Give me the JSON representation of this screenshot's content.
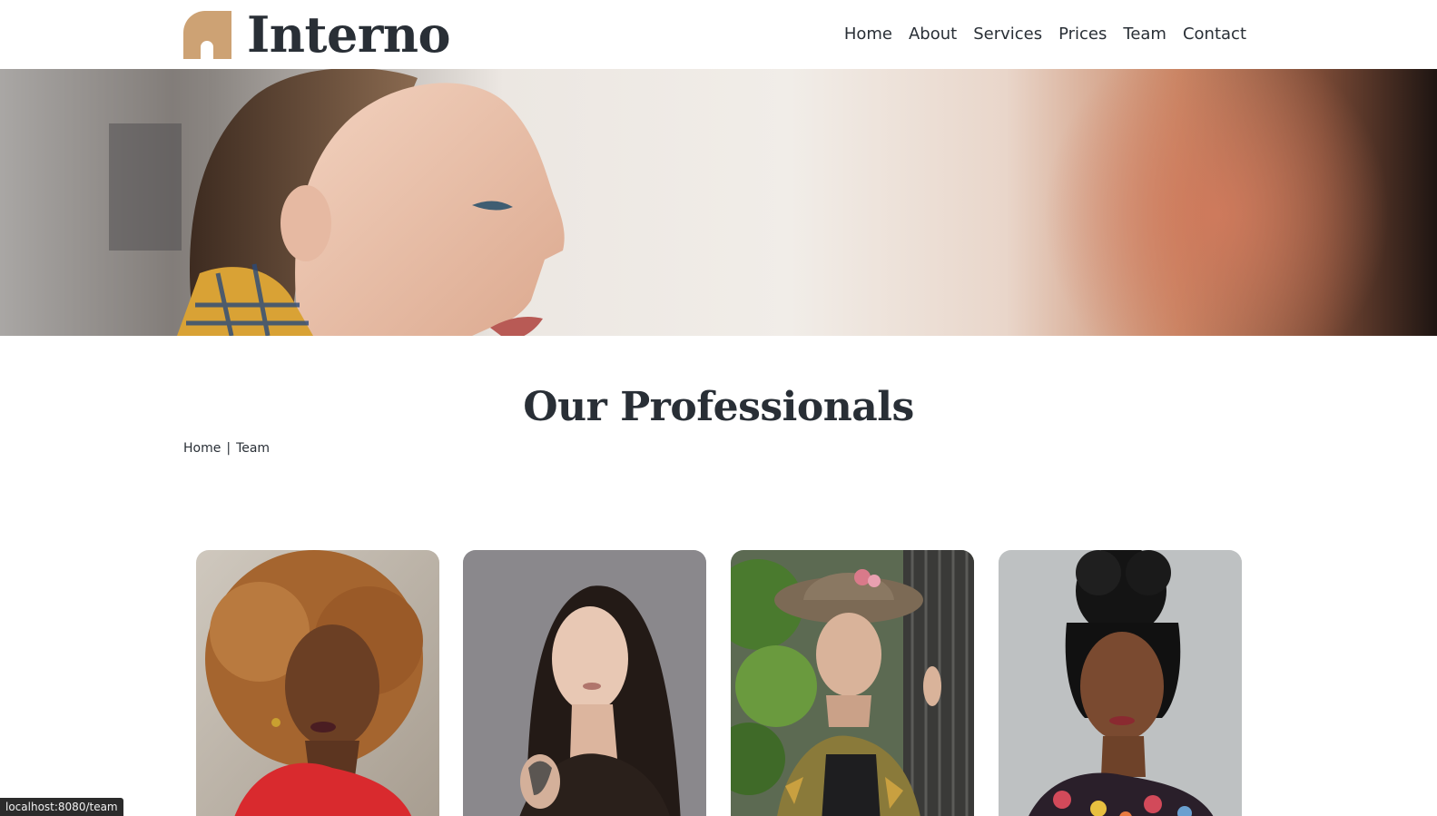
{
  "brand": {
    "name": "Interno",
    "accent": "#CDA274",
    "text_color": "#292F36"
  },
  "nav": {
    "items": [
      {
        "label": "Home"
      },
      {
        "label": "About"
      },
      {
        "label": "Services"
      },
      {
        "label": "Prices"
      },
      {
        "label": "Team"
      },
      {
        "label": "Contact"
      }
    ]
  },
  "hero": {
    "image": "woman-profile-smiling-photo"
  },
  "page": {
    "title": "Our Professionals",
    "breadcrumb": {
      "home": "Home",
      "separator": "|",
      "current": "Team"
    }
  },
  "team": {
    "cards": [
      {
        "image": "woman-curly-hair-red-top-photo"
      },
      {
        "image": "woman-long-dark-hair-tattoo-photo"
      },
      {
        "image": "woman-hat-patterned-jacket-photo"
      },
      {
        "image": "woman-braided-updo-floral-top-photo"
      }
    ]
  },
  "status_bar": {
    "url": "localhost:8080/team"
  }
}
